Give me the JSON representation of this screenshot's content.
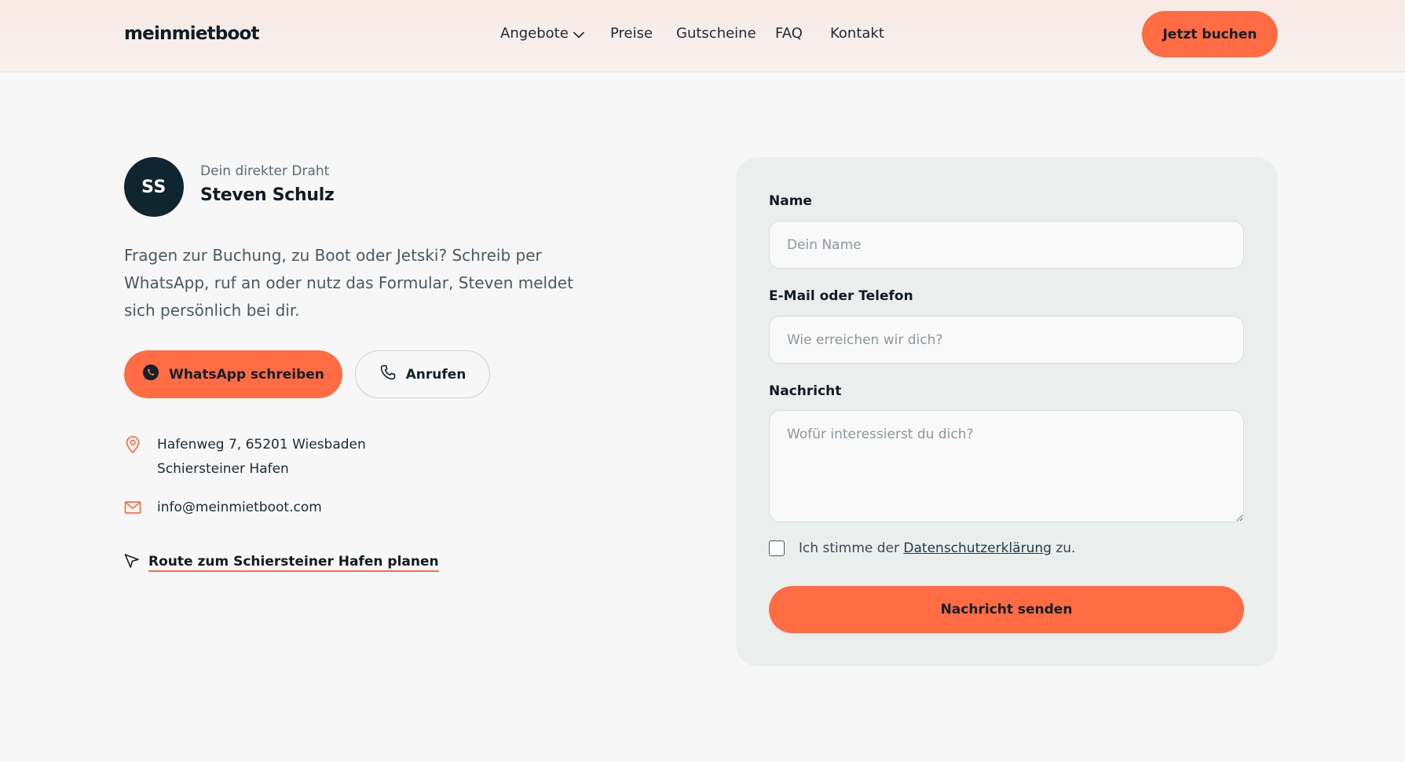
{
  "header": {
    "logo": "meinmietboot",
    "nav": [
      {
        "label": "Angebote",
        "has_dropdown": true
      },
      {
        "label": "Preise"
      },
      {
        "label": "Gutscheine"
      },
      {
        "label": "FAQ"
      },
      {
        "label": "Kontakt"
      }
    ],
    "cta_label": "Jetzt buchen"
  },
  "contact": {
    "avatar_initials": "SS",
    "subtitle": "Dein direkter Draht",
    "name": "Steven Schulz",
    "intro": "Fragen zur Buchung, zu Boot oder Jetski? Schreib per WhatsApp, ruf an oder nutz das Formular, Steven meldet sich persönlich bei dir.",
    "whatsapp_label": "WhatsApp schreiben",
    "call_label": "Anrufen",
    "address_line1": "Hafenweg 7, 65201 Wiesbaden",
    "address_line2": "Schiersteiner Hafen",
    "email": "info@meinmietboot.com",
    "route_label": "Route zum Schiersteiner Hafen planen",
    "icons": {
      "address": "map-pin-icon",
      "email": "mail-icon",
      "route": "navigation-arrow-icon",
      "whatsapp": "whatsapp-icon",
      "call": "phone-icon"
    }
  },
  "form": {
    "name_label": "Name",
    "name_placeholder": "Dein Name",
    "contact_label": "E-Mail oder Telefon",
    "contact_placeholder": "Wie erreichen wir dich?",
    "message_label": "Nachricht",
    "message_placeholder": "Wofür interessierst du dich?",
    "consent_prefix": "Ich stimme der ",
    "consent_link": "Datenschutzerklärung",
    "consent_suffix": " zu.",
    "consent_checked": false,
    "submit_label": "Nachricht senden"
  },
  "colors": {
    "accent": "#ff6b43",
    "dark": "#0f2530",
    "card": "#eaefed",
    "background": "#f6f7f6"
  }
}
